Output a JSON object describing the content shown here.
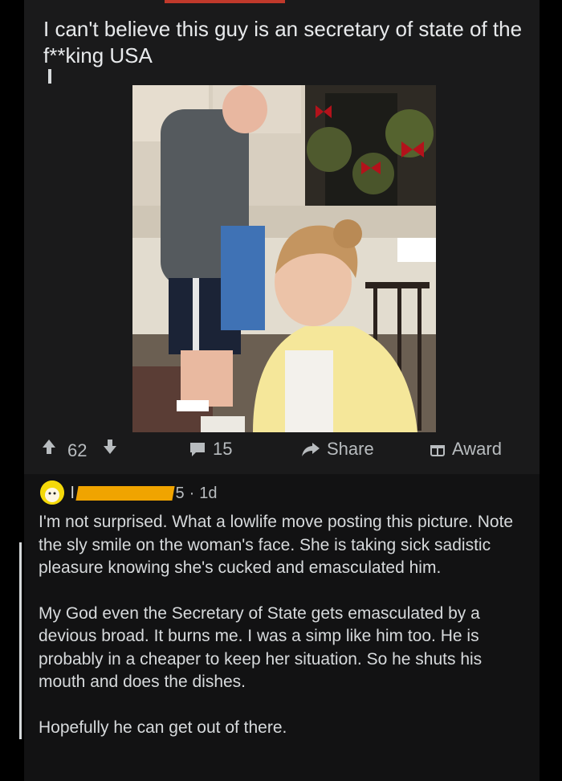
{
  "post": {
    "title": "I can't believe this guy is an secretary of state of the f**king USA",
    "image_alt": "photo"
  },
  "actions": {
    "vote_count": "62",
    "comment_count": "15",
    "share_label": "Share",
    "award_label": "Award"
  },
  "comment": {
    "username_initial": "l",
    "username_tail": "5",
    "separator": "·",
    "age": "1d",
    "paragraphs": [
      "I'm not surprised.  What a lowlife move posting this picture.  Note the sly smile on the woman's face.  She is taking sick sadistic pleasure knowing she's cucked and emasculated him.",
      "My God even the Secretary of State gets emasculated by a devious broad.  It burns me.  I was a simp like him too. He is probably in a cheaper to keep her situation.  So he shuts his mouth and does the dishes.",
      "Hopefully he can get out of there."
    ]
  },
  "colors": {
    "background": "#000000",
    "card": "#1a1a1b",
    "text": "#d7dadc",
    "redaction": "#f0a400",
    "avatar": "#f5d90a"
  }
}
